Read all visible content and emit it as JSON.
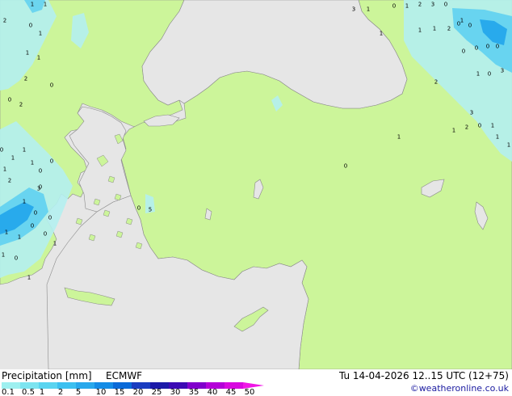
{
  "legend": {
    "title": "Precipitation [mm]",
    "model": "ECMWF",
    "scale_labels": [
      "0.1",
      "0.5",
      "1",
      "2",
      "5",
      "10",
      "15",
      "20",
      "25",
      "30",
      "35",
      "40",
      "45",
      "50"
    ],
    "scale_colors": [
      "#9ef0f0",
      "#7ce4f0",
      "#5ad4f0",
      "#3cc0f0",
      "#28a8ec",
      "#148ce6",
      "#0a6ad8",
      "#1a3cc0",
      "#1c1aa8",
      "#3c0ab4",
      "#8000cc",
      "#b400d8",
      "#d808e0"
    ]
  },
  "valid_time": "Tu 14-04-2026 12..15 UTC (12+75)",
  "credit": "©weatheronline.co.uk",
  "map": {
    "land_color": "#ccf59a",
    "sea_color": "#e6e6e6",
    "rain_light_color": "#b4f0f0",
    "rain_mid_color": "#64d2f0",
    "rain_heavy_color": "#28aaec",
    "labels": [
      "1",
      "1",
      "2",
      "0",
      "1",
      "1",
      "1",
      "2",
      "0",
      "2",
      "0",
      "1",
      "1",
      "1",
      "0",
      "1",
      "0",
      "0",
      "0",
      "1",
      "1",
      "1",
      "0",
      "3",
      "0",
      "1",
      "0",
      "5",
      "3",
      "1",
      "0",
      "1",
      "2",
      "3",
      "0",
      "1",
      "0",
      "1",
      "1",
      "1",
      "2",
      "0",
      "0",
      "0",
      "0",
      "0",
      "1",
      "0",
      "3",
      "2",
      "1",
      "2",
      "0",
      "1",
      "3",
      "1",
      "1",
      "1",
      "0",
      "0",
      "0",
      "1",
      "2",
      "0",
      "1"
    ]
  }
}
